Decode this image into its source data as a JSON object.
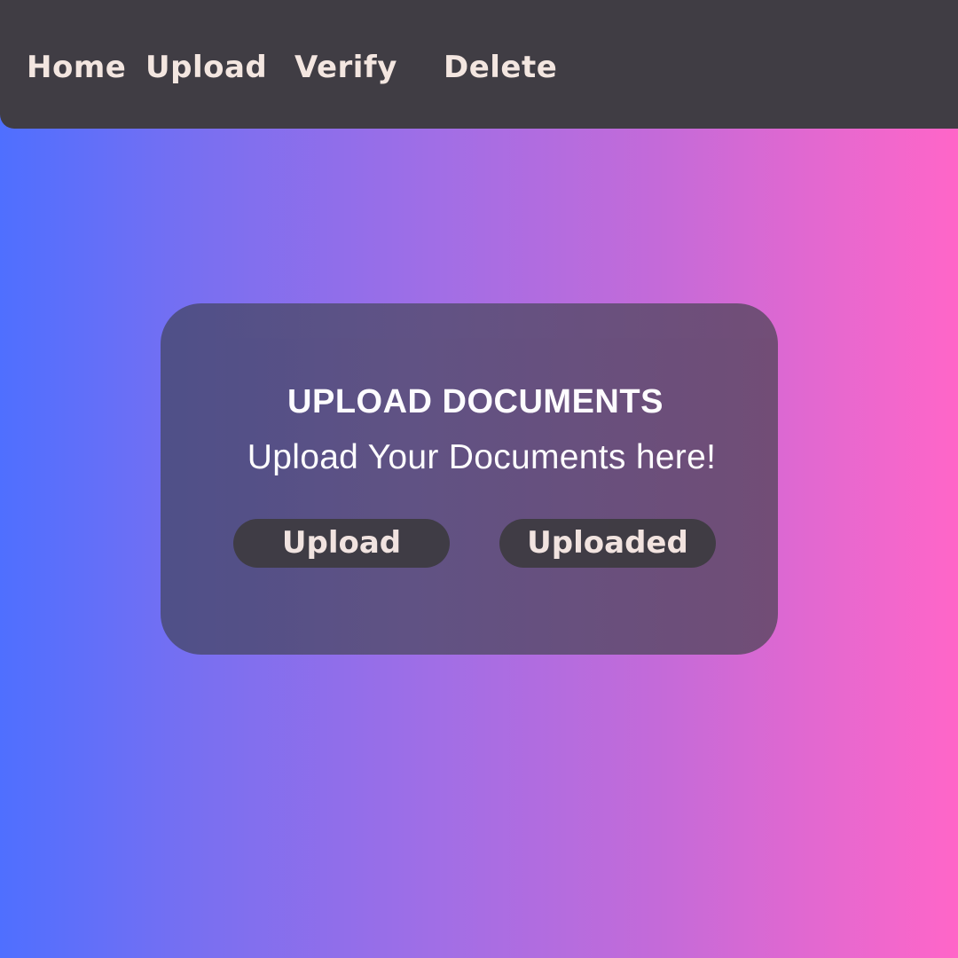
{
  "nav": {
    "items": [
      {
        "label": "Home"
      },
      {
        "label": "Upload"
      },
      {
        "label": "Verify"
      },
      {
        "label": "Delete"
      }
    ]
  },
  "card": {
    "title": "UPLOAD DOCUMENTS",
    "subtitle": "Upload Your Documents here!",
    "buttons": {
      "upload_label": "Upload",
      "uploaded_label": "Uploaded"
    }
  },
  "colors": {
    "navbar_bg": "#403d44",
    "nav_text": "#f3e6e0",
    "gradient_left": "#4f6fff",
    "gradient_right": "#ff66c8",
    "button_bg": "#3e3c42"
  }
}
